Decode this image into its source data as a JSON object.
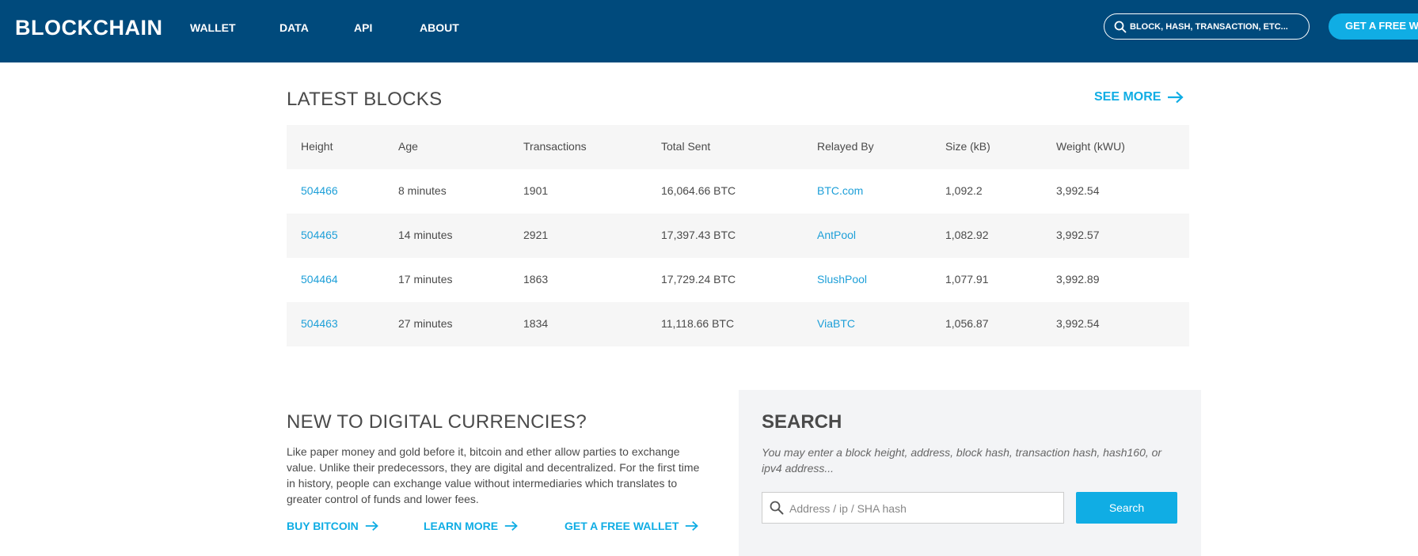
{
  "header": {
    "logo": "BLOCKCHAIN",
    "nav": [
      "WALLET",
      "DATA",
      "API",
      "ABOUT"
    ],
    "search_placeholder": "BLOCK, HASH, TRANSACTION, ETC...",
    "cta": "GET A FREE WA"
  },
  "latest_blocks": {
    "title": "LATEST BLOCKS",
    "see_more": "SEE MORE",
    "columns": [
      "Height",
      "Age",
      "Transactions",
      "Total Sent",
      "Relayed By",
      "Size (kB)",
      "Weight (kWU)"
    ],
    "rows": [
      {
        "height": "504466",
        "age": "8 minutes",
        "transactions": "1901",
        "total_sent": "16,064.66 BTC",
        "relayed_by": "BTC.com",
        "size": "1,092.2",
        "weight": "3,992.54"
      },
      {
        "height": "504465",
        "age": "14 minutes",
        "transactions": "2921",
        "total_sent": "17,397.43 BTC",
        "relayed_by": "AntPool",
        "size": "1,082.92",
        "weight": "3,992.57"
      },
      {
        "height": "504464",
        "age": "17 minutes",
        "transactions": "1863",
        "total_sent": "17,729.24 BTC",
        "relayed_by": "SlushPool",
        "size": "1,077.91",
        "weight": "3,992.89"
      },
      {
        "height": "504463",
        "age": "27 minutes",
        "transactions": "1834",
        "total_sent": "11,118.66 BTC",
        "relayed_by": "ViaBTC",
        "size": "1,056.87",
        "weight": "3,992.54"
      }
    ]
  },
  "new_to_digital": {
    "title": "NEW TO DIGITAL CURRENCIES?",
    "text": "Like paper money and gold before it, bitcoin and ether allow parties to exchange value. Unlike their predecessors, they are digital and decentralized. For the first time in history, people can exchange value without intermediaries which translates to greater control of funds and lower fees.",
    "links": [
      "BUY BITCOIN",
      "LEARN MORE",
      "GET A FREE WALLET"
    ]
  },
  "search": {
    "title": "SEARCH",
    "description": "You may enter a block height, address, block hash, transaction hash, hash160, or ipv4 address...",
    "placeholder": "Address / ip / SHA hash",
    "button": "Search"
  },
  "icons": {
    "search": "search-icon",
    "arrow": "arrow-right-icon"
  },
  "colors": {
    "header_bg": "#004a7c",
    "accent": "#10ade4",
    "link": "#1d9fd8"
  }
}
